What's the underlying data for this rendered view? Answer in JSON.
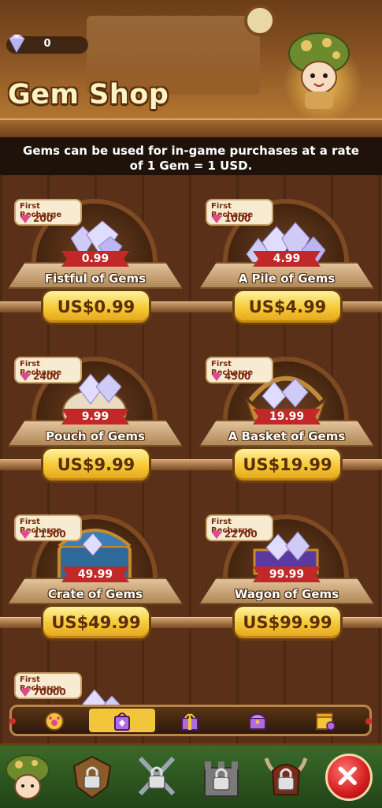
{
  "header": {
    "title": "Gem Shop",
    "gem_balance": "0"
  },
  "info_text": "Gems can be used for in-game purchases at a rate of 1 Gem = 1 USD.",
  "packs": [
    {
      "badge_label": "First Recharge",
      "bonus": "200",
      "ribbon": "0.99",
      "name": "Fistful of Gems",
      "price": "US$0.99"
    },
    {
      "badge_label": "First Recharge",
      "bonus": "1000",
      "ribbon": "4.99",
      "name": "A Pile of Gems",
      "price": "US$4.99"
    },
    {
      "badge_label": "First Recharge",
      "bonus": "2400",
      "ribbon": "9.99",
      "name": "Pouch of Gems",
      "price": "US$9.99"
    },
    {
      "badge_label": "First Recharge",
      "bonus": "4500",
      "ribbon": "19.99",
      "name": "A Basket of Gems",
      "price": "US$19.99"
    },
    {
      "badge_label": "First Recharge",
      "bonus": "11500",
      "ribbon": "49.99",
      "name": "Crate of Gems",
      "price": "US$49.99"
    },
    {
      "badge_label": "First Recharge",
      "bonus": "22700",
      "ribbon": "99.99",
      "name": "Wagon of Gems",
      "price": "US$99.99"
    },
    {
      "badge_label": "First Recharge",
      "bonus": "70000"
    }
  ],
  "category_tabs": [
    {
      "icon": "paw-badge-icon",
      "active": false
    },
    {
      "icon": "gem-bag-icon",
      "active": true
    },
    {
      "icon": "gift-box-icon",
      "active": false
    },
    {
      "icon": "chest-icon",
      "active": false
    },
    {
      "icon": "timed-shop-icon",
      "active": false
    }
  ],
  "bottom_nav": [
    {
      "icon": "mushroom-hero-icon"
    },
    {
      "icon": "locked-shield-icon"
    },
    {
      "icon": "locked-swords-icon"
    },
    {
      "icon": "locked-castle-icon"
    },
    {
      "icon": "locked-horned-helmet-icon"
    },
    {
      "icon": "close-icon"
    }
  ],
  "colors": {
    "button_gold": "#f6cb3a",
    "ribbon_red": "#c22828",
    "wood_dark": "#4a2812",
    "nav_green": "#3a6a2a"
  }
}
